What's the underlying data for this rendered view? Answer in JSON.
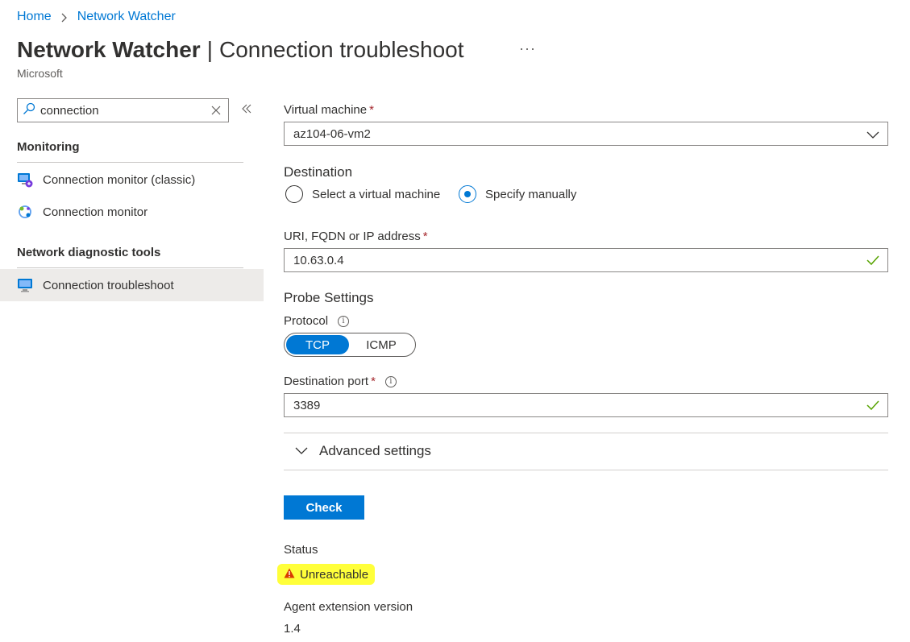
{
  "breadcrumb": {
    "home": "Home",
    "current": "Network Watcher"
  },
  "header": {
    "title_bold": "Network Watcher",
    "separator": "|",
    "title_rest": "Connection troubleshoot",
    "more": "···",
    "subtitle": "Microsoft"
  },
  "sidebar": {
    "search_value": "connection",
    "sections": [
      {
        "label": "Monitoring",
        "items": [
          {
            "label": "Connection monitor (classic)",
            "icon": "connection-monitor-classic-icon"
          },
          {
            "label": "Connection monitor",
            "icon": "connection-monitor-icon"
          }
        ]
      },
      {
        "label": "Network diagnostic tools",
        "items": [
          {
            "label": "Connection troubleshoot",
            "icon": "connection-troubleshoot-icon",
            "active": true
          }
        ]
      }
    ]
  },
  "form": {
    "vm_label": "Virtual machine",
    "required_mark": "*",
    "vm_value": "az104-06-vm2",
    "destination_label": "Destination",
    "dest_option_vm": "Select a virtual machine",
    "dest_option_manual": "Specify manually",
    "dest_selected": "Specify manually",
    "uri_label": "URI, FQDN or IP address",
    "uri_value": "10.63.0.4",
    "probe_heading": "Probe Settings",
    "protocol_label": "Protocol",
    "protocol_tcp": "TCP",
    "protocol_icmp": "ICMP",
    "protocol_selected": "TCP",
    "port_label": "Destination port",
    "port_value": "3389",
    "advanced_label": "Advanced settings",
    "check_button": "Check"
  },
  "result": {
    "status_label": "Status",
    "status_value": "Unreachable",
    "agent_label": "Agent extension version",
    "agent_value": "1.4"
  },
  "colors": {
    "accent": "#0078d4",
    "highlight": "#ffff3a",
    "valid": "#57a300",
    "warning": "#d83b01",
    "required": "#a4262c"
  }
}
